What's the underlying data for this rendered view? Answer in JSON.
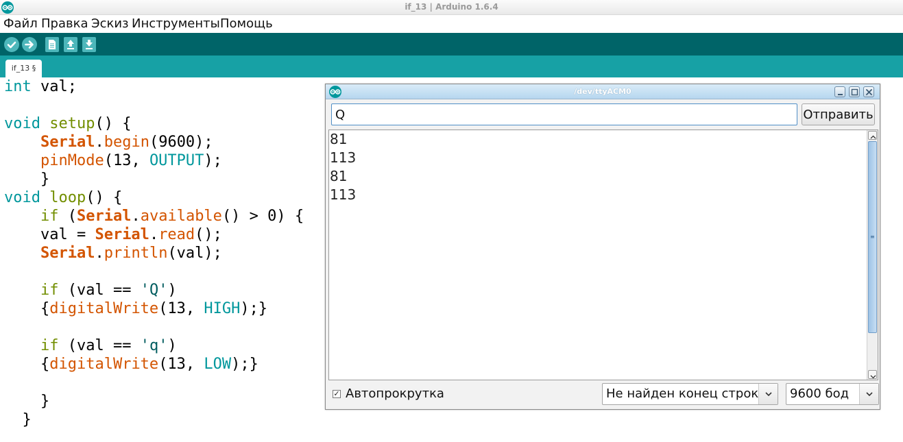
{
  "window": {
    "title": "if_13 | Arduino 1.6.4"
  },
  "menu": {
    "items": [
      "Файл",
      "Правка",
      "Эскиз",
      "Инструменты",
      "Помощь"
    ]
  },
  "toolbar": {
    "buttons": [
      "verify-icon",
      "upload-icon",
      "new-icon",
      "open-icon",
      "save-icon"
    ],
    "background_color": "#006468",
    "button_color": "#4db7bb"
  },
  "tabs": {
    "active_label": "if_13 §",
    "strip_color": "#17a1a5"
  },
  "editor": {
    "lines": [
      "int val;",
      "",
      "void setup() {",
      "    Serial.begin(9600);",
      "    pinMode(13, OUTPUT);",
      "    }",
      "void loop() {",
      "    if (Serial.available() > 0) {",
      "    val = Serial.read();",
      "    Serial.println(val);",
      "",
      "    if (val == 'Q')",
      "    {digitalWrite(13, HIGH);}",
      "",
      "    if (val == 'q')",
      "    {digitalWrite(13, LOW);}",
      "",
      "    }",
      "  }"
    ],
    "colors": {
      "keyword": "#00979c",
      "function": "#d35400",
      "control": "#728e00"
    }
  },
  "serial_monitor": {
    "title": "/dev/ttyACM0",
    "input_value": "Q",
    "send_label": "Отправить",
    "output_lines": [
      "81",
      "113",
      "81",
      "113"
    ],
    "autoscroll_checked": true,
    "autoscroll_label": "Автопрокрутка",
    "line_ending": "Не найден конец строки",
    "baud_rate": "9600 бод"
  }
}
